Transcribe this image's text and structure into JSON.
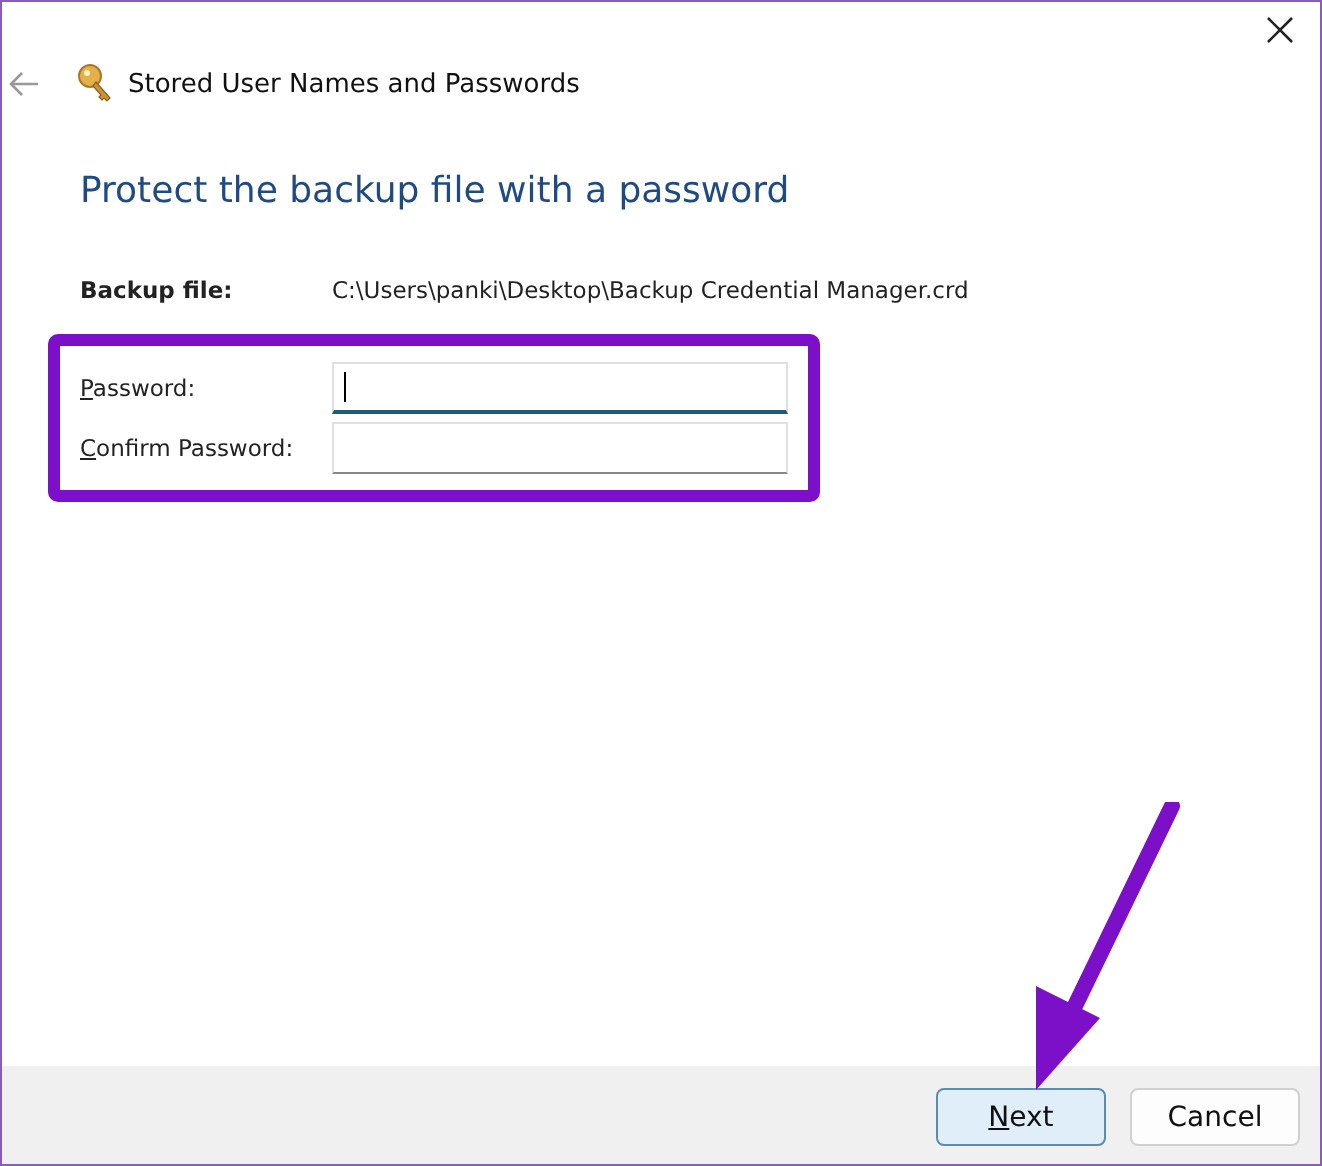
{
  "window": {
    "title": "Stored User Names and Passwords"
  },
  "heading": "Protect the backup file with a password",
  "backup_file": {
    "label": "Backup file:",
    "value": "C:\\Users\\panki\\Desktop\\Backup Credential Manager.crd"
  },
  "fields": [
    {
      "label": "Password:",
      "mnemonic": true,
      "focused": true
    },
    {
      "label": "Confirm Password:",
      "mnemonic": true,
      "focused": false
    }
  ],
  "buttons": [
    {
      "label": "Next",
      "mnemonic": true,
      "default": true
    },
    {
      "label": "Cancel",
      "mnemonic": false,
      "default": false
    }
  ],
  "annotations": {
    "highlight_frame": true,
    "arrow": true
  }
}
